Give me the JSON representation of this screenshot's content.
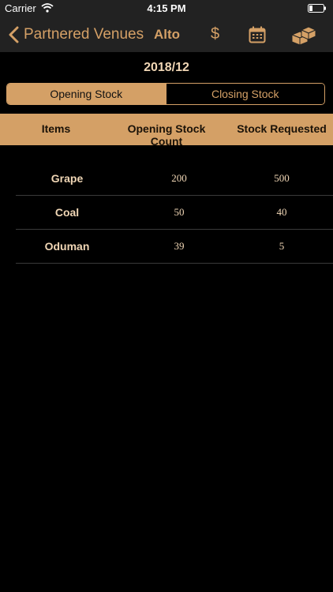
{
  "status_bar": {
    "carrier": "Carrier",
    "time": "4:15 PM"
  },
  "nav": {
    "back_label": "Partnered Venues",
    "venue": "Alto",
    "dollar_symbol": "$",
    "icons": [
      "chevron-left-icon",
      "dollar-icon",
      "calendar-icon",
      "boxes-icon"
    ]
  },
  "period": "2018/12",
  "tabs": {
    "opening": "Opening Stock",
    "closing": "Closing Stock",
    "selected": "Opening Stock"
  },
  "table": {
    "headers": [
      "Items",
      "Opening Stock Count",
      "Stock Requested"
    ],
    "rows": [
      {
        "item": "Grape",
        "opening": "200",
        "requested": "500"
      },
      {
        "item": "Coal",
        "opening": "50",
        "requested": "40"
      },
      {
        "item": "Oduman",
        "opening": "39",
        "requested": "5"
      }
    ]
  },
  "colors": {
    "accent": "#d4a066",
    "background": "#000000",
    "nav": "#222222",
    "text": "#f0d6b5"
  }
}
